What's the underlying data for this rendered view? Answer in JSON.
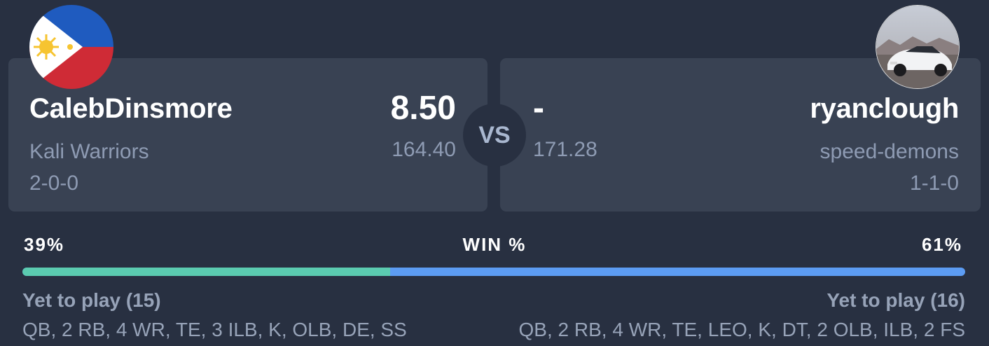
{
  "home": {
    "name": "CalebDinsmore",
    "team": "Kali Warriors",
    "record": "2-0-0",
    "score": "8.50",
    "projected": "164.40",
    "avatar_icon": "philippines-flag",
    "win_pct": "39%",
    "win_fraction": 0.39,
    "yet_to_play": "Yet to play (15)",
    "positions": "QB, 2 RB, 4 WR, TE, 3 ILB, K, OLB, DE, SS"
  },
  "away": {
    "name": "ryanclough",
    "team": "speed-demons",
    "record": "1-1-0",
    "score": "-",
    "projected": "171.28",
    "avatar_icon": "white-sports-car-photo",
    "win_pct": "61%",
    "yet_to_play": "Yet to play (16)",
    "positions": "QB, 2 RB, 4 WR, TE, LEO, K, DT, 2 OLB, ILB, 2 FS"
  },
  "vs_label": "VS",
  "win_label": "WIN %",
  "colors": {
    "background": "#283041",
    "card": "#394253",
    "home_bar": "#5bcbb0",
    "away_bar": "#5c9cf3",
    "muted_text": "#8e9bb3"
  }
}
